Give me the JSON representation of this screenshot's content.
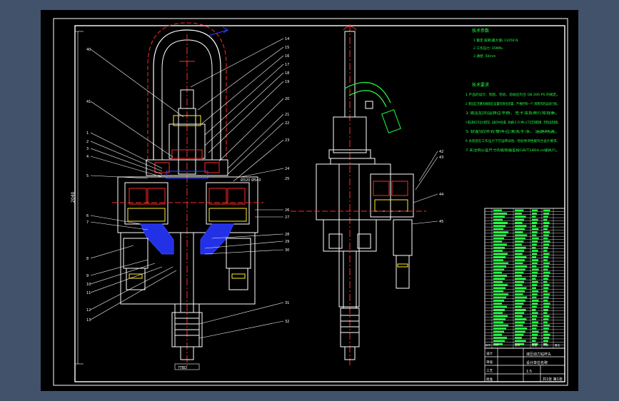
{
  "colors": {
    "background_outer": "#41526a",
    "drawing_bg": "#000000",
    "line_white": "#ffffff",
    "accent_red": "#ff2a2a",
    "accent_blue": "#3344ff",
    "accent_yellow": "#ffee22",
    "accent_green": "#22ff44",
    "accent_cyan": "#33ddee"
  },
  "tech_params": {
    "title": "技术参数",
    "items": [
      "1  额定 扭矩(最大值) 11050 N",
      "2  工作压力:  35MPa",
      "3  通径:  50mm"
    ]
  },
  "tech_requirements": {
    "title": "技术要求",
    "items": [
      "1  产品的设计、制造、检验、验收应符合 GB-200 PS 的规定。",
      "2  液压缸活塞的端部应设置有限位装置、严格控制一个 周转内的运动行程。",
      "3  液压缸的运转应平稳、无卡滞及爬行等现象。",
      "4  液压系统工作压力调定后、压板在中间位置、各油路 在 35 MPa 以下应无渗漏现象、无明显发热现象。",
      "5  装配前所有零件应清洗干净、油路畅通。",
      "6  总装后在工作压力下空运转试验、检验各项性能符合设计要求。",
      "7  未注明公差尺寸的极限偏差按GB/T1804-m级执行。"
    ]
  },
  "dimensions": {
    "height_label": "2040",
    "bottom_label": "?TBD",
    "flange_label": "Ø320 Ø540"
  },
  "part_labels_left": [
    "40",
    "41",
    "1",
    "2",
    "3",
    "4",
    "5",
    "6",
    "7",
    "8",
    "9",
    "10",
    "11",
    "12",
    "13",
    "14",
    "15",
    "16",
    "17",
    "18",
    "19",
    "20",
    "21",
    "22",
    "23",
    "24",
    "25",
    "26",
    "27",
    "28",
    "29",
    "30",
    "31",
    "32",
    "33",
    "34",
    "35"
  ],
  "part_labels_right": [
    "42",
    "43",
    "44",
    "45"
  ],
  "title_block": {
    "drawing_title": "液压动力钻杆头",
    "company": "设计单位名称",
    "scale": "1:5",
    "sheet": "共1张 第1张",
    "rows": [
      "设计",
      "审核",
      "工艺",
      "批准"
    ]
  },
  "bom": {
    "header": [
      "序号",
      "代号",
      "名称",
      "数量",
      "材料",
      "备注"
    ],
    "rows_count_text": "45"
  }
}
